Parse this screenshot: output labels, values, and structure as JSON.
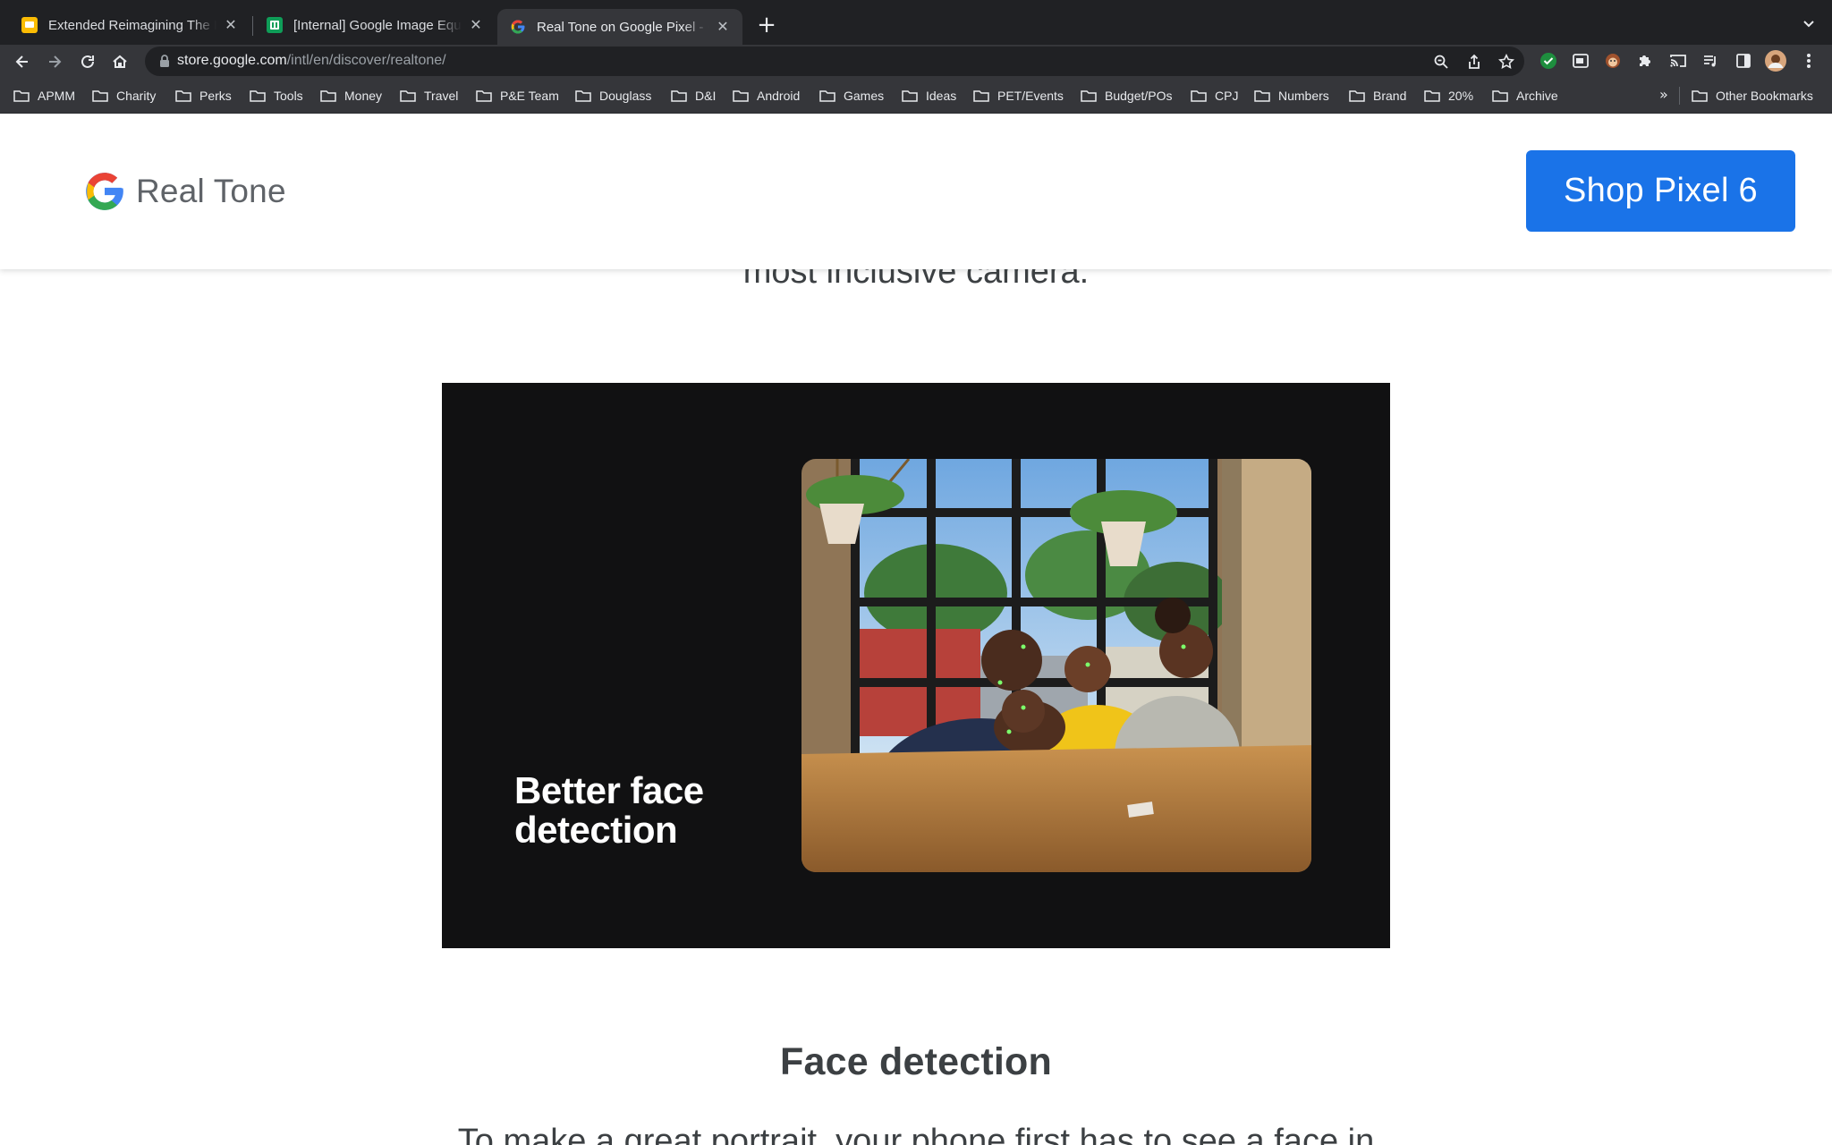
{
  "browser": {
    "tabs": [
      {
        "title": "Extended Reimagining The Image",
        "favicon": "slides-icon",
        "color": "#fbbc04"
      },
      {
        "title": "[Internal] Google Image Equity",
        "favicon": "sheets-icon",
        "color": "#0f9d58"
      },
      {
        "title": "Real Tone on Google Pixel - Google Store",
        "favicon": "google-icon",
        "active": true
      }
    ],
    "address": {
      "host": "store.google.com",
      "path": "/intl/en/discover/realtone/"
    },
    "bookmarks": [
      "APMM",
      "Charity",
      "Perks",
      "Tools",
      "Money",
      "Travel",
      "P&E Team",
      "Douglass",
      "D&I",
      "Android",
      "Games",
      "Ideas",
      "PET/Events",
      "Budget/POs",
      "CPJ",
      "Numbers",
      "Brand",
      "20%",
      "Archive"
    ],
    "bookmarks_overflow": "»",
    "other_bookmarks": "Other Bookmarks"
  },
  "site": {
    "brand_name": "Real Tone",
    "cta_label": "Shop Pixel 6",
    "accent_color": "#1a73e8"
  },
  "content": {
    "lead_line": "most inclusive camera.",
    "video_caption_line1": "Better face",
    "video_caption_line2": "detection",
    "section_title": "Face detection",
    "body_line": "To make a great portrait, your phone first has to see a face in"
  }
}
